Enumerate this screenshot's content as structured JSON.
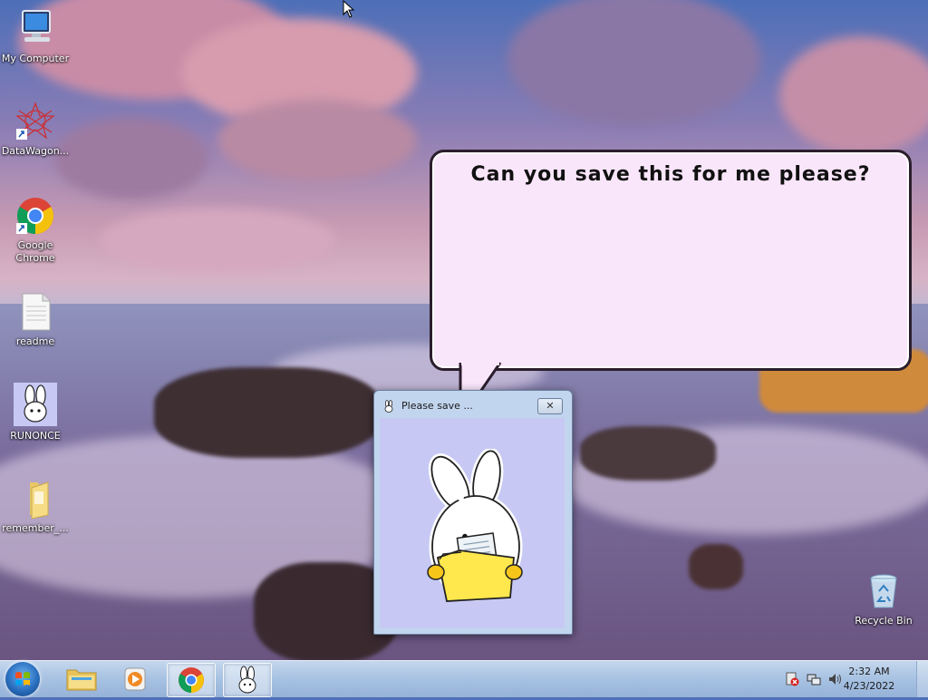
{
  "desktop_icons": [
    {
      "label": "My Computer",
      "icon": "computer-icon"
    },
    {
      "label": "DataWagon...",
      "icon": "datawagon-icon"
    },
    {
      "label": "Google Chrome",
      "icon": "chrome-icon"
    },
    {
      "label": "readme",
      "icon": "text-file-icon"
    },
    {
      "label": "RUNONCE",
      "icon": "bunny-icon"
    },
    {
      "label": "remember_...",
      "icon": "folder-icon"
    },
    {
      "label": "Recycle Bin",
      "icon": "recycle-bin-icon"
    }
  ],
  "speech_bubble": {
    "text": "Can you save this for me please?"
  },
  "dialog": {
    "title": "Please save ...",
    "close_glyph": "✕"
  },
  "taskbar": {
    "items": [
      "start-orb-icon",
      "file-explorer-icon",
      "media-player-icon",
      "chrome-icon",
      "bunny-icon"
    ],
    "clock": {
      "time": "2:32 AM",
      "date": "4/23/2022"
    }
  },
  "colors": {
    "bubble_fill": "#fae6fb",
    "dialog_client": "#c7c9f4",
    "folder": "#ffe84d"
  }
}
